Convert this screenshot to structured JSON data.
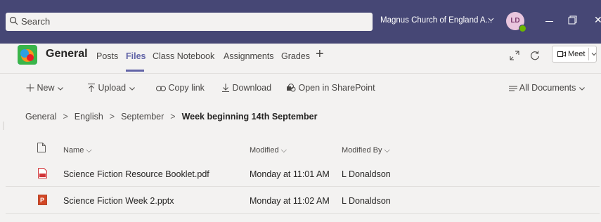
{
  "titlebar": {
    "search_placeholder": "Search",
    "org_name": "Magnus Church of England A...",
    "avatar_initials": "LD",
    "colors": {
      "bar": "#464775",
      "presence": "#6bb700"
    }
  },
  "channel": {
    "name": "General",
    "tabs": [
      {
        "label": "Posts",
        "active": false
      },
      {
        "label": "Files",
        "active": true
      },
      {
        "label": "Class Notebook",
        "active": false
      },
      {
        "label": "Assignments",
        "active": false
      },
      {
        "label": "Grades",
        "active": false
      }
    ],
    "add_tab": "+",
    "meet_label": "Meet"
  },
  "commands": {
    "new": "New",
    "upload": "Upload",
    "copy_link": "Copy link",
    "download": "Download",
    "open_sharepoint": "Open in SharePoint",
    "view": "All Documents"
  },
  "breadcrumb": [
    "General",
    "English",
    "September",
    "Week beginning 14th September"
  ],
  "table": {
    "headers": {
      "name": "Name",
      "modified": "Modified",
      "modified_by": "Modified By"
    },
    "rows": [
      {
        "icon": "pdf-icon",
        "name": "Science Fiction Resource Booklet.pdf",
        "modified": "Monday at 11:01 AM",
        "modified_by": "L Donaldson"
      },
      {
        "icon": "pptx-icon",
        "name": "Science Fiction Week 2.pptx",
        "modified": "Monday at 11:02 AM",
        "modified_by": "L Donaldson"
      }
    ]
  },
  "accent_color": "#6264a7"
}
